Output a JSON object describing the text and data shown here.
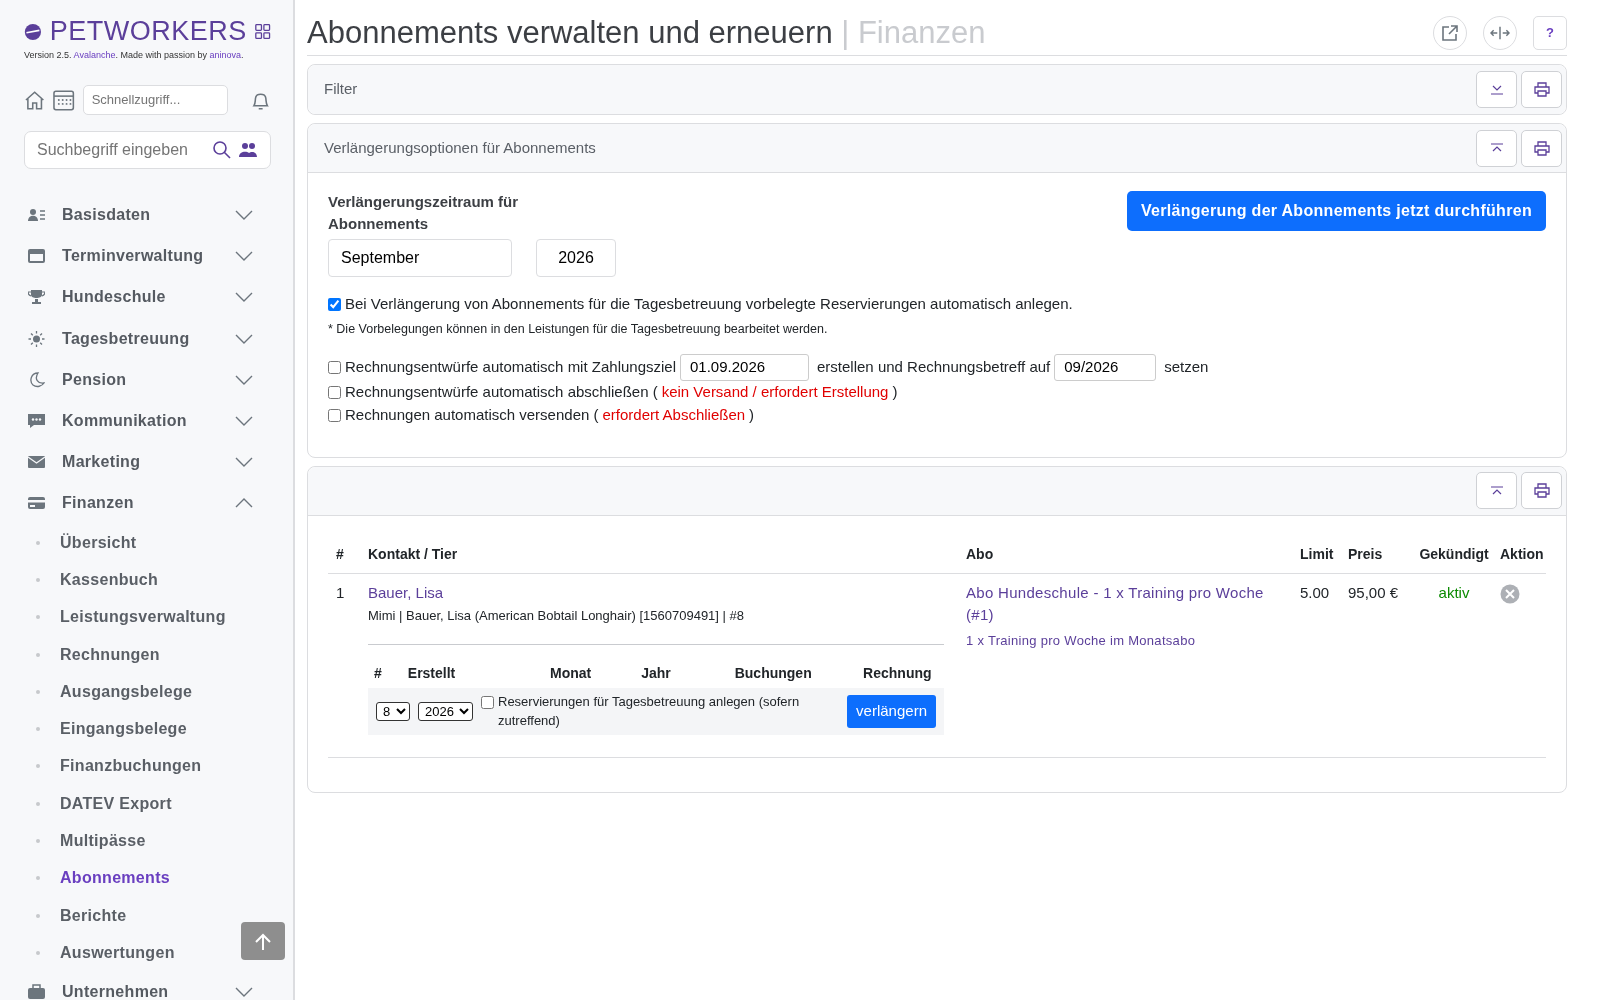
{
  "brand": {
    "logo": "PETWORKERS",
    "version_parts": [
      {
        "text": "Version 2.5.",
        "highlight": false
      },
      {
        "text": "Avalanche",
        "highlight": true
      },
      {
        "text": ". Made with passion by",
        "highlight": false
      },
      {
        "text": "aninova",
        "highlight": true
      },
      {
        "text": "."
      }
    ]
  },
  "quick_access": {
    "placeholder": "Schnellzugriff..."
  },
  "search": {
    "placeholder": "Suchbegriff eingeben"
  },
  "sidebar": {
    "items": [
      {
        "label": "Basisdaten",
        "expanded": false
      },
      {
        "label": "Terminverwaltung",
        "expanded": false
      },
      {
        "label": "Hundeschule",
        "expanded": false
      },
      {
        "label": "Tagesbetreuung",
        "expanded": false
      },
      {
        "label": "Pension",
        "expanded": false
      },
      {
        "label": "Kommunikation",
        "expanded": false
      },
      {
        "label": "Marketing",
        "expanded": false
      },
      {
        "label": "Finanzen",
        "expanded": true,
        "children": [
          {
            "label": "Übersicht",
            "selected": false
          },
          {
            "label": "Kassenbuch",
            "selected": false
          },
          {
            "label": "Leistungsverwaltung",
            "selected": false
          },
          {
            "label": "Rechnungen",
            "selected": false
          },
          {
            "label": "Ausgangsbelege",
            "selected": false
          },
          {
            "label": "Eingangsbelege",
            "selected": false
          },
          {
            "label": "Finanzbuchungen",
            "selected": false
          },
          {
            "label": "DATEV Export",
            "selected": false
          },
          {
            "label": "Multipässe",
            "selected": false
          },
          {
            "label": "Abonnements",
            "selected": true
          },
          {
            "label": "Berichte",
            "selected": false
          },
          {
            "label": "Auswertungen",
            "selected": false
          }
        ]
      },
      {
        "label": "Unternehmen",
        "expanded": false
      }
    ]
  },
  "header": {
    "title": "Abonnements verwalten und erneuern",
    "separator": "|",
    "section": "Finanzen",
    "help": "?"
  },
  "panels": [
    {
      "title": "Filter",
      "expanded": false
    },
    {
      "kind": "options",
      "title": "Verlängerungsoptionen für Abonnements",
      "expanded": true
    },
    {
      "kind": "results",
      "expanded": true
    }
  ],
  "options": {
    "period_label": "Verlängerungszeitraum für Abonnements",
    "month": "September",
    "year": "2026",
    "run_button": "Verlängerung der Abonnements jetzt durchführen",
    "reserve": {
      "checked": true,
      "label": "Bei Verlängerung von Abonnements für die Tagesbetreuung vorbelegte Reservierungen automatisch anlegen.",
      "note": "* Die Vorbelegungen können in den Leistungen für die Tagesbetreuung bearbeitet werden."
    },
    "invoice_options": [
      {
        "checked": false,
        "parts": [
          {
            "kind": "text",
            "text": "Rechnungsentwürfe automatisch mit Zahlungsziel"
          },
          {
            "kind": "field",
            "text": "01.09.2026"
          },
          {
            "kind": "text",
            "text": "erstellen und Rechnungsbetreff auf"
          },
          {
            "kind": "field",
            "text": "09/2026"
          },
          {
            "kind": "text",
            "text": "setzen"
          }
        ]
      },
      {
        "checked": false,
        "parts": [
          {
            "kind": "text",
            "text": "Rechnungsentwürfe automatisch abschließen ("
          },
          {
            "kind": "warning",
            "text": "kein Versand / erfordert Erstellung"
          },
          {
            "kind": "text",
            "text": ")"
          }
        ]
      },
      {
        "checked": false,
        "parts": [
          {
            "kind": "text",
            "text": "Rechnungen automatisch versenden ("
          },
          {
            "kind": "warning",
            "text": "erfordert Abschließen"
          },
          {
            "kind": "text",
            "text": ")"
          }
        ]
      }
    ]
  },
  "table": {
    "columns": [
      "#",
      "Kontakt / Tier",
      "Abo",
      "Limit",
      "Preis",
      "Gekündigt",
      "Aktion"
    ],
    "rows": [
      {
        "index": "1",
        "contact": "Bauer, Lisa",
        "pet": "Mimi | Bauer, Lisa (American Bobtail Longhair) [1560709491] | #8",
        "abo": "Abo Hundeschule - 1 x Training pro Woche (#1)",
        "abo_detail": "1 x Training pro Woche im Monatsabo",
        "limit": "5.00",
        "price": "95,00 €",
        "status": "aktiv",
        "renewals": {
          "columns": [
            "#",
            "Erstellt",
            "Monat",
            "Jahr",
            "Buchungen",
            "Rechnung"
          ],
          "rows": [
            {
              "month": "8",
              "year": "2026",
              "reserve_checked": false,
              "reserve_label": "Reservierungen für Tagesbetreuung anlegen (sofern zutreffend)",
              "button": "verlängern"
            }
          ]
        }
      }
    ]
  }
}
